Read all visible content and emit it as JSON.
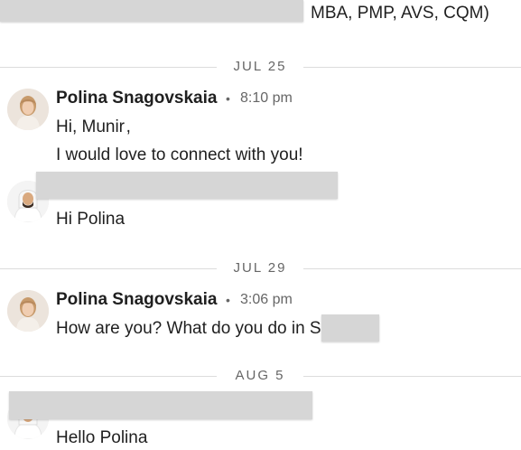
{
  "top_snippet": {
    "text": "MBA, PMP, AVS, CQM)"
  },
  "dividers": [
    {
      "label": "JUL 25"
    },
    {
      "label": "JUL 29"
    },
    {
      "label": "AUG 5"
    }
  ],
  "messages": [
    {
      "sender": "Polina Snagovskaia",
      "time": "8:10 pm",
      "lines": [
        "Hi, Munir ,",
        "I would love to connect with you!"
      ]
    },
    {
      "sender": "",
      "time": "",
      "lines": [
        "Hi Polina"
      ]
    },
    {
      "sender": "Polina Snagovskaia",
      "time": "3:06 pm",
      "lines": [
        "How are you? What do you do in S"
      ]
    },
    {
      "sender": "",
      "time": "",
      "lines": [
        "Hello Polina"
      ]
    }
  ],
  "separator_dot": "•"
}
